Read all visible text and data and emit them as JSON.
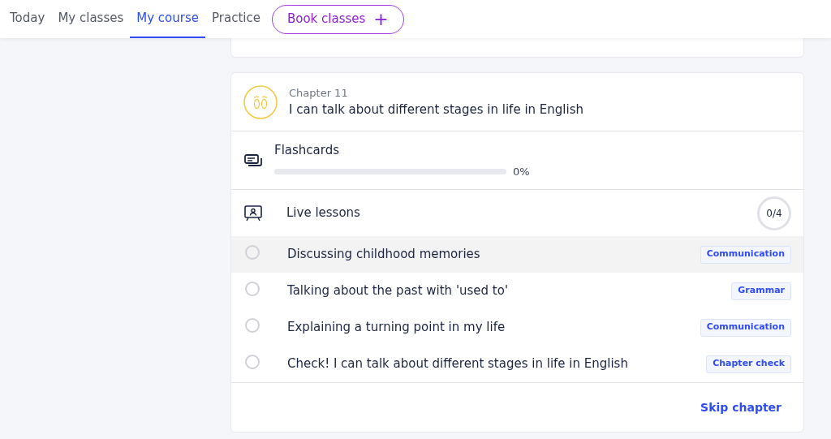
{
  "nav": {
    "tabs": [
      {
        "label": "Today",
        "selected": false
      },
      {
        "label": "My classes",
        "selected": false
      },
      {
        "label": "My course",
        "selected": true
      },
      {
        "label": "Practice",
        "selected": false
      }
    ],
    "book_button": {
      "label": "Book classes",
      "icon": "+"
    }
  },
  "chapter": {
    "number": "Chapter 11",
    "title": "I can talk about different stages in life in English",
    "flashcards": {
      "label": "Flashcards",
      "level": 0,
      "reading": "0%"
    },
    "live_lessons": {
      "label": "Live lessons",
      "progress": "0/4",
      "lessons": [
        {
          "title": "Discussing childhood memories",
          "tag": "Communication",
          "highlighted": true,
          "completed": false
        },
        {
          "title": "Talking about the past with 'used to'",
          "tag": "Grammar",
          "highlighted": false,
          "completed": false
        },
        {
          "title": "Explaining a turning point in my life",
          "tag": "Communication",
          "highlighted": false,
          "completed": false
        },
        {
          "title": "Check! I can talk about different stages in life in English",
          "tag": "Chapter check",
          "highlighted": false,
          "completed": false
        }
      ]
    },
    "skip_link": "Skip chapter"
  }
}
